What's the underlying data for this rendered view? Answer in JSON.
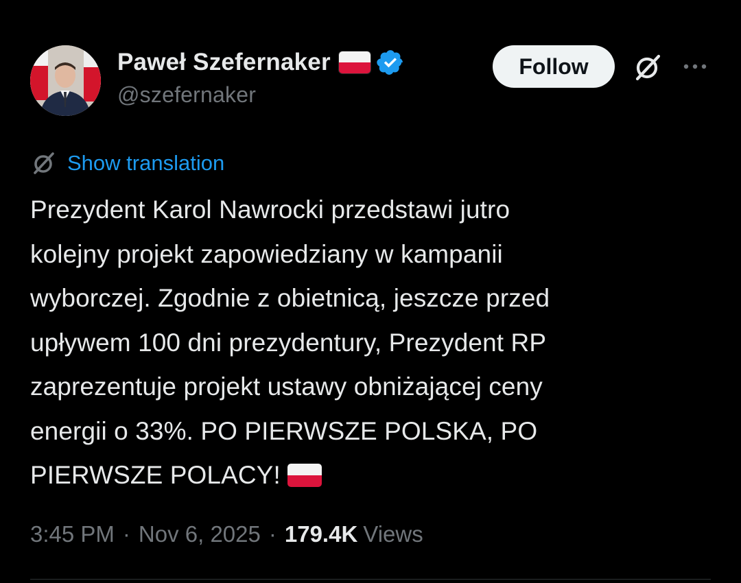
{
  "author": {
    "display_name": "Paweł Szefernaker",
    "handle": "@szefernaker",
    "flag_icon": "poland-flag-icon",
    "verified_icon": "verified-badge-icon",
    "avatar_icon": "avatar"
  },
  "actions": {
    "follow_label": "Follow",
    "grok_icon": "grok-icon",
    "more_icon": "more-options-icon"
  },
  "translation": {
    "icon": "translate-icon",
    "label": "Show translation"
  },
  "tweet": {
    "text": "Prezydent Karol Nawrocki przedstawi jutro\nkolejny projekt zapowiedziany w kampanii\nwyborczej. Zgodnie z obietnicą, jeszcze przed\nupływem 100 dni prezydentury, Prezydent RP\nzaprezentuje projekt ustawy obniżającej ceny\nenergii o 33%. PO PIERWSZE POLSKA, PO\nPIERWSZE POLACY!",
    "trailing_emoji": "poland-flag-icon"
  },
  "meta": {
    "time": "3:45 PM",
    "separator": "·",
    "date": "Nov 6, 2025",
    "views_count": "179.4K",
    "views_label": "Views"
  },
  "colors": {
    "background": "#000000",
    "text": "#e7e9ea",
    "secondary": "#71767b",
    "link": "#1d9bf0",
    "verified": "#1d9bf0",
    "follow_bg": "#eff3f4",
    "flag_red": "#dc143c"
  }
}
